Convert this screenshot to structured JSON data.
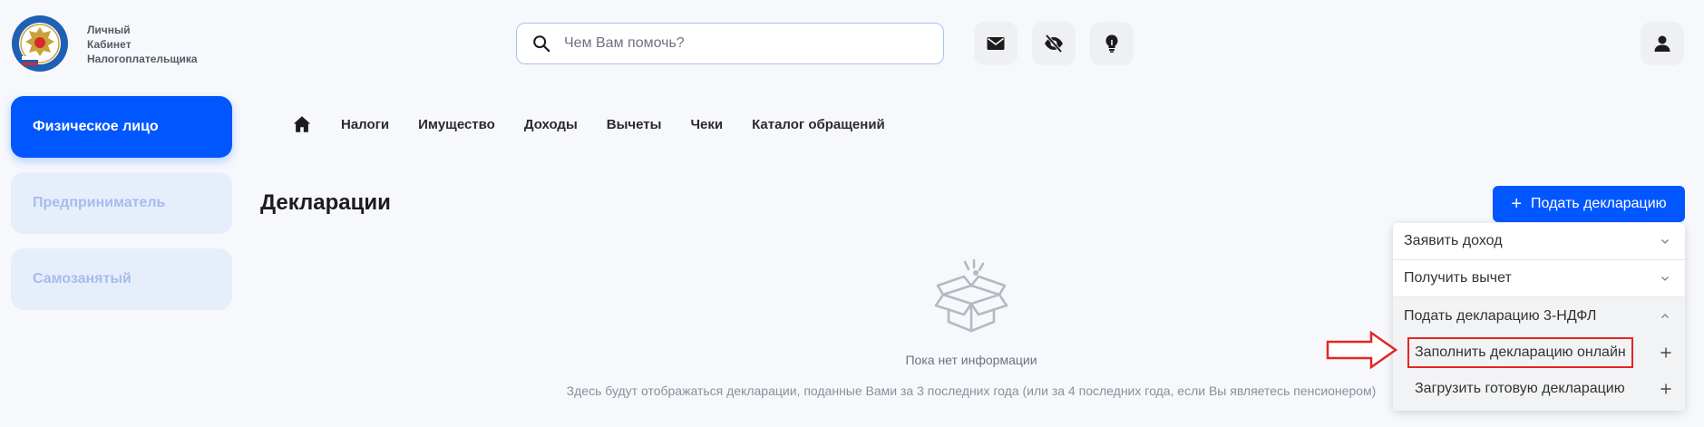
{
  "header": {
    "logo_lines": [
      "Личный",
      "Кабинет",
      "Налогоплательщика"
    ],
    "search_placeholder": "Чем Вам помочь?"
  },
  "sidebar": {
    "items": [
      {
        "label": "Физическое лицо",
        "active": true
      },
      {
        "label": "Предприниматель",
        "active": false
      },
      {
        "label": "Самозанятый",
        "active": false
      }
    ]
  },
  "nav": {
    "items": [
      "Налоги",
      "Имущество",
      "Доходы",
      "Вычеты",
      "Чеки",
      "Каталог обращений"
    ]
  },
  "main": {
    "title": "Декларации",
    "submit_button_label": "Подать декларацию",
    "empty_title": "Пока нет информации",
    "empty_description": "Здесь будут отображаться декларации, поданные Вами за 3 последних года (или за 4 последних года, если Вы являетесь пенсионером)"
  },
  "dropdown": {
    "items": [
      {
        "label": "Заявить доход",
        "expanded": false
      },
      {
        "label": "Получить вычет",
        "expanded": false
      },
      {
        "label": "Подать декларацию 3-НДФЛ",
        "expanded": true
      }
    ],
    "subitems": [
      {
        "label": "Заполнить декларацию онлайн",
        "highlighted": true
      },
      {
        "label": "Загрузить готовую декларацию",
        "highlighted": false
      }
    ]
  },
  "colors": {
    "accent": "#0057ff",
    "annotation": "#e32626",
    "page_background": "#f6f8fc"
  }
}
